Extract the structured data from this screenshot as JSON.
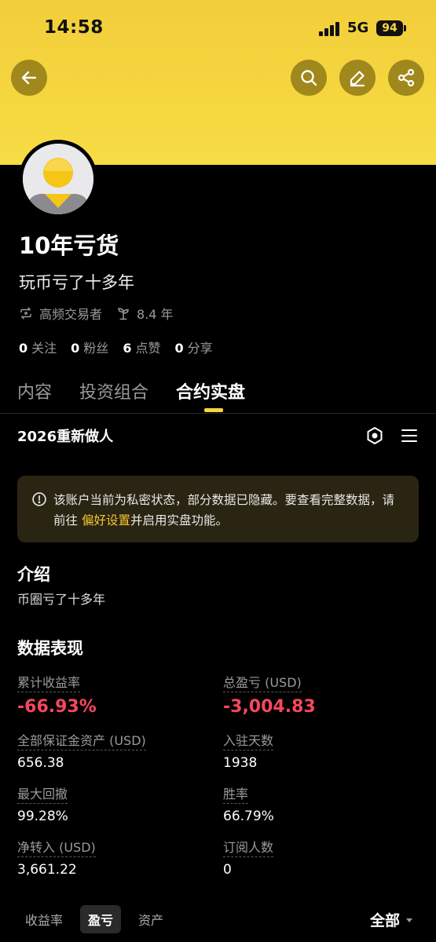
{
  "status": {
    "time": "14:58",
    "network": "5G",
    "battery": "94"
  },
  "header": {
    "back_icon": "arrow-left-icon",
    "search_icon": "search-icon",
    "edit_icon": "pencil-icon",
    "share_icon": "share-icon",
    "accent": "#f5d63f"
  },
  "profile": {
    "name": "10年亏货",
    "bio": "玩币亏了十多年",
    "tags": [
      {
        "icon": "repeat-icon",
        "label": "高频交易者"
      },
      {
        "icon": "sprout-icon",
        "label": "8.4 年"
      }
    ],
    "stats": [
      {
        "num": "0",
        "label": "关注"
      },
      {
        "num": "0",
        "label": "粉丝"
      },
      {
        "num": "6",
        "label": "点赞"
      },
      {
        "num": "0",
        "label": "分享"
      }
    ]
  },
  "tabs": [
    {
      "label": "内容",
      "active": false
    },
    {
      "label": "投资组合",
      "active": false
    },
    {
      "label": "合约实盘",
      "active": true
    }
  ],
  "portfolio": {
    "name": "2026重新做人"
  },
  "notice": {
    "text_before": "该账户当前为私密状态，部分数据已隐藏。要查看完整数据，请前往 ",
    "link": "偏好设置",
    "text_after": "并启用实盘功能。"
  },
  "intro": {
    "title": "介绍",
    "text": "币圈亏了十多年"
  },
  "performance": {
    "title": "数据表现",
    "metrics": [
      {
        "label": "累计收益率",
        "value": "-66.93%"
      },
      {
        "label": "总盈亏 (USD)",
        "value": "-3,004.83"
      },
      {
        "label": "全部保证金资产 (USD)",
        "value": "656.38"
      },
      {
        "label": "入驻天数",
        "value": "1938"
      },
      {
        "label": "最大回撤",
        "value": "99.28%"
      },
      {
        "label": "胜率",
        "value": "66.79%"
      },
      {
        "label": "净转入 (USD)",
        "value": "3,661.22"
      },
      {
        "label": "订阅人数",
        "value": "0"
      }
    ],
    "negative_color": "#f5475e"
  },
  "bottom_tabs": {
    "items": [
      {
        "label": "收益率",
        "active": false
      },
      {
        "label": "盈亏",
        "active": true
      },
      {
        "label": "资产",
        "active": false
      }
    ],
    "filter": "全部"
  }
}
